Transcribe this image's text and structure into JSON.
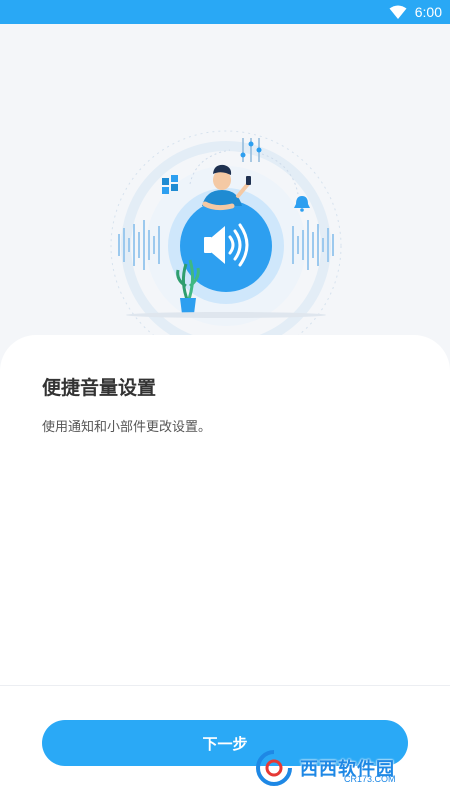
{
  "status_bar": {
    "time": "6:00",
    "icons": [
      "wifi-icon"
    ],
    "background": "#29a8f5"
  },
  "hero": {
    "illustration": "person-with-speaker-illustration",
    "icons": [
      "speaker-volume-icon",
      "grid-widget-icon",
      "bell-icon",
      "equalizer-icon",
      "plant-icon"
    ]
  },
  "sheet": {
    "title": "便捷音量设置",
    "description": "使用通知和小部件更改设置。"
  },
  "actions": {
    "next_label": "下一步",
    "accent": "#2aa9f6"
  },
  "watermark": {
    "brand": "西西软件园",
    "domain": "CR173.COM"
  }
}
